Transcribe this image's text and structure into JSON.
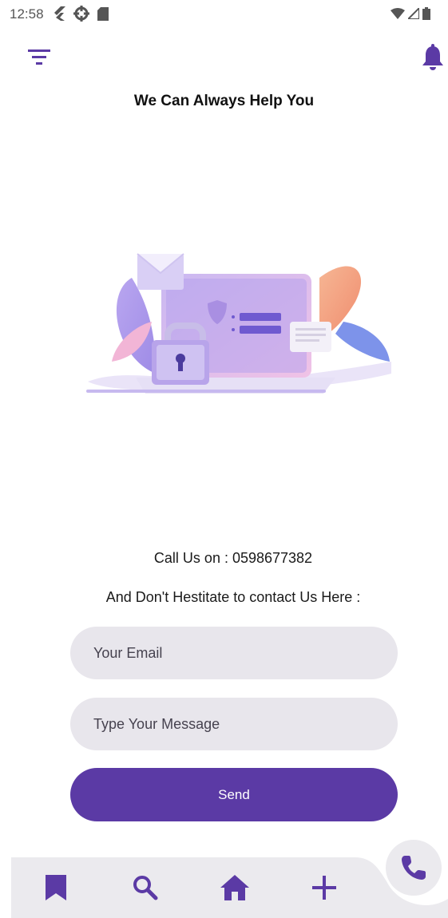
{
  "status_bar": {
    "time": "12:58",
    "icons_left": [
      "flutter-icon",
      "settings-icon",
      "sd-card-icon"
    ],
    "icons_right": [
      "wifi-icon",
      "signal-icon",
      "battery-icon"
    ]
  },
  "app_bar": {
    "title": "We Can Always Help You",
    "left_icon": "filter-icon",
    "right_icon": "bell-icon"
  },
  "content": {
    "illustration": "security-laptop-illustration",
    "call_text": "Call Us on : 0598677382",
    "contact_text": "And Don't Hestitate to contact Us Here :"
  },
  "form": {
    "email_placeholder": "Your Email",
    "message_placeholder": "Type Your Message",
    "send_label": "Send"
  },
  "bottom_nav": {
    "items": [
      "bookmark-icon",
      "search-icon",
      "home-icon",
      "add-icon"
    ],
    "fab": "phone-icon"
  },
  "colors": {
    "primary": "#5b3aa5",
    "field_bg": "#e8e6ec",
    "nav_bg": "#ebeaee"
  }
}
